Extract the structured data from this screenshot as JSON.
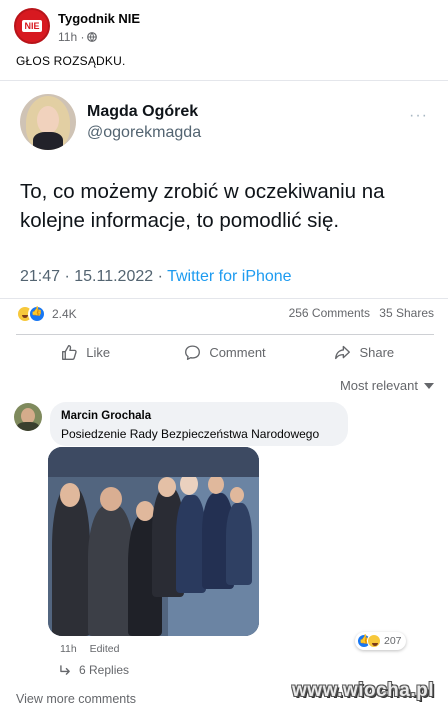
{
  "post": {
    "page_name": "Tygodnik NIE",
    "time": "11h ·",
    "text": "GŁOS ROZSĄDKU.",
    "avatar_text": "NIE"
  },
  "tweet": {
    "name": "Magda Ogórek",
    "handle": "@ogorekmagda",
    "more": "···",
    "text": "To, co możemy zrobić w oczekiwaniu na kolejne informacje, to pomodlić się.",
    "date": "21:47 · 15.11.2022 · ",
    "source": "Twitter for iPhone"
  },
  "stats": {
    "reaction_count": "2.4K",
    "comments": "256 Comments",
    "shares": "35 Shares"
  },
  "actions": {
    "like": "Like",
    "comment": "Comment",
    "share": "Share"
  },
  "sort": {
    "label": "Most relevant"
  },
  "comment": {
    "author": "Marcin Grochala",
    "text": "Posiedzenie Rady Bezpieczeństwa Narodowego",
    "time": "11h",
    "edited": "Edited",
    "reaction_count": "207",
    "replies": "6 Replies"
  },
  "view_more": "View more comments",
  "watermark": "www.wiocha.pl",
  "colors": {
    "link_blue": "#1d9bf0",
    "facebook_blue": "#1877f2",
    "nie_red": "#d71920"
  }
}
